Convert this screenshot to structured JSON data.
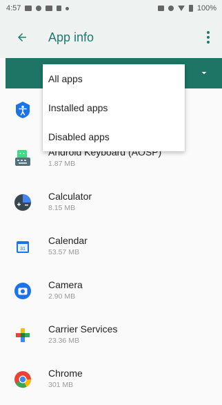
{
  "status_bar": {
    "time": "4:57",
    "battery": "100%"
  },
  "app_bar": {
    "title": "App info",
    "back_icon": "arrow-back-icon",
    "menu_icon": "more-vert-icon"
  },
  "filter": {
    "chevron_icon": "chevron-down-icon"
  },
  "dropdown": {
    "items": [
      {
        "label": "All apps"
      },
      {
        "label": "Installed apps"
      },
      {
        "label": "Disabled apps"
      }
    ]
  },
  "apps": [
    {
      "name": "",
      "size": "",
      "icon": "accessibility-icon"
    },
    {
      "name": "Android Keyboard (AOSP)",
      "size": "1.87 MB",
      "icon": "keyboard-icon"
    },
    {
      "name": "Calculator",
      "size": "8.15 MB",
      "icon": "calculator-icon"
    },
    {
      "name": "Calendar",
      "size": "53.57 MB",
      "icon": "calendar-icon"
    },
    {
      "name": "Camera",
      "size": "2.90 MB",
      "icon": "camera-icon"
    },
    {
      "name": "Carrier Services",
      "size": "23.36 MB",
      "icon": "carrier-services-icon"
    },
    {
      "name": "Chrome",
      "size": "301 MB",
      "icon": "chrome-icon"
    }
  ],
  "colors": {
    "accent": "#1d7a6c",
    "filter_bar": "#1e7565",
    "background": "#fafafa"
  }
}
